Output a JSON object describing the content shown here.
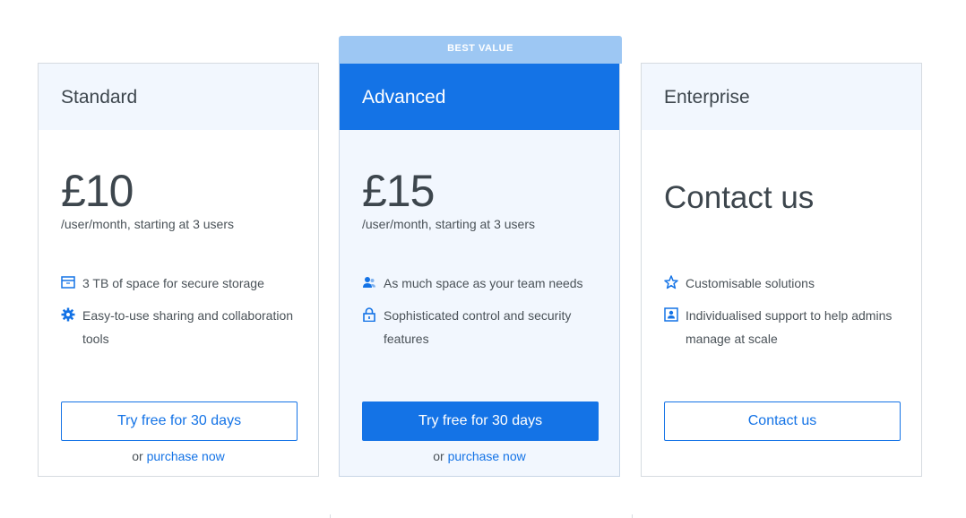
{
  "plans": [
    {
      "name": "Standard",
      "price": "£10",
      "price_note": "/user/month, starting at 3 users",
      "features": [
        {
          "icon": "storage-box-icon",
          "text": "3 TB of space for secure storage"
        },
        {
          "icon": "gear-icon",
          "text": "Easy-to-use sharing and collaboration tools"
        }
      ],
      "button_label": "Try free for 30 days",
      "sub_prefix": "or",
      "sub_link": "purchase now"
    },
    {
      "name": "Advanced",
      "badge": "BEST VALUE",
      "price": "£15",
      "price_note": "/user/month, starting at 3 users",
      "features": [
        {
          "icon": "team-users-icon",
          "text": "As much space as your team needs"
        },
        {
          "icon": "lock-icon",
          "text": "Sophisticated control and security features"
        }
      ],
      "button_label": "Try free for 30 days",
      "sub_prefix": "or",
      "sub_link": "purchase now"
    },
    {
      "name": "Enterprise",
      "price_text": "Contact us",
      "features": [
        {
          "icon": "star-icon",
          "text": "Customisable solutions"
        },
        {
          "icon": "support-badge-icon",
          "text": "Individualised support to help admins manage at scale"
        }
      ],
      "button_label": "Contact us"
    }
  ],
  "colors": {
    "accent": "#1473e6",
    "badge_bg": "#9dc7f3",
    "header_bg": "#f2f7fe",
    "border": "#d6dbe0"
  }
}
